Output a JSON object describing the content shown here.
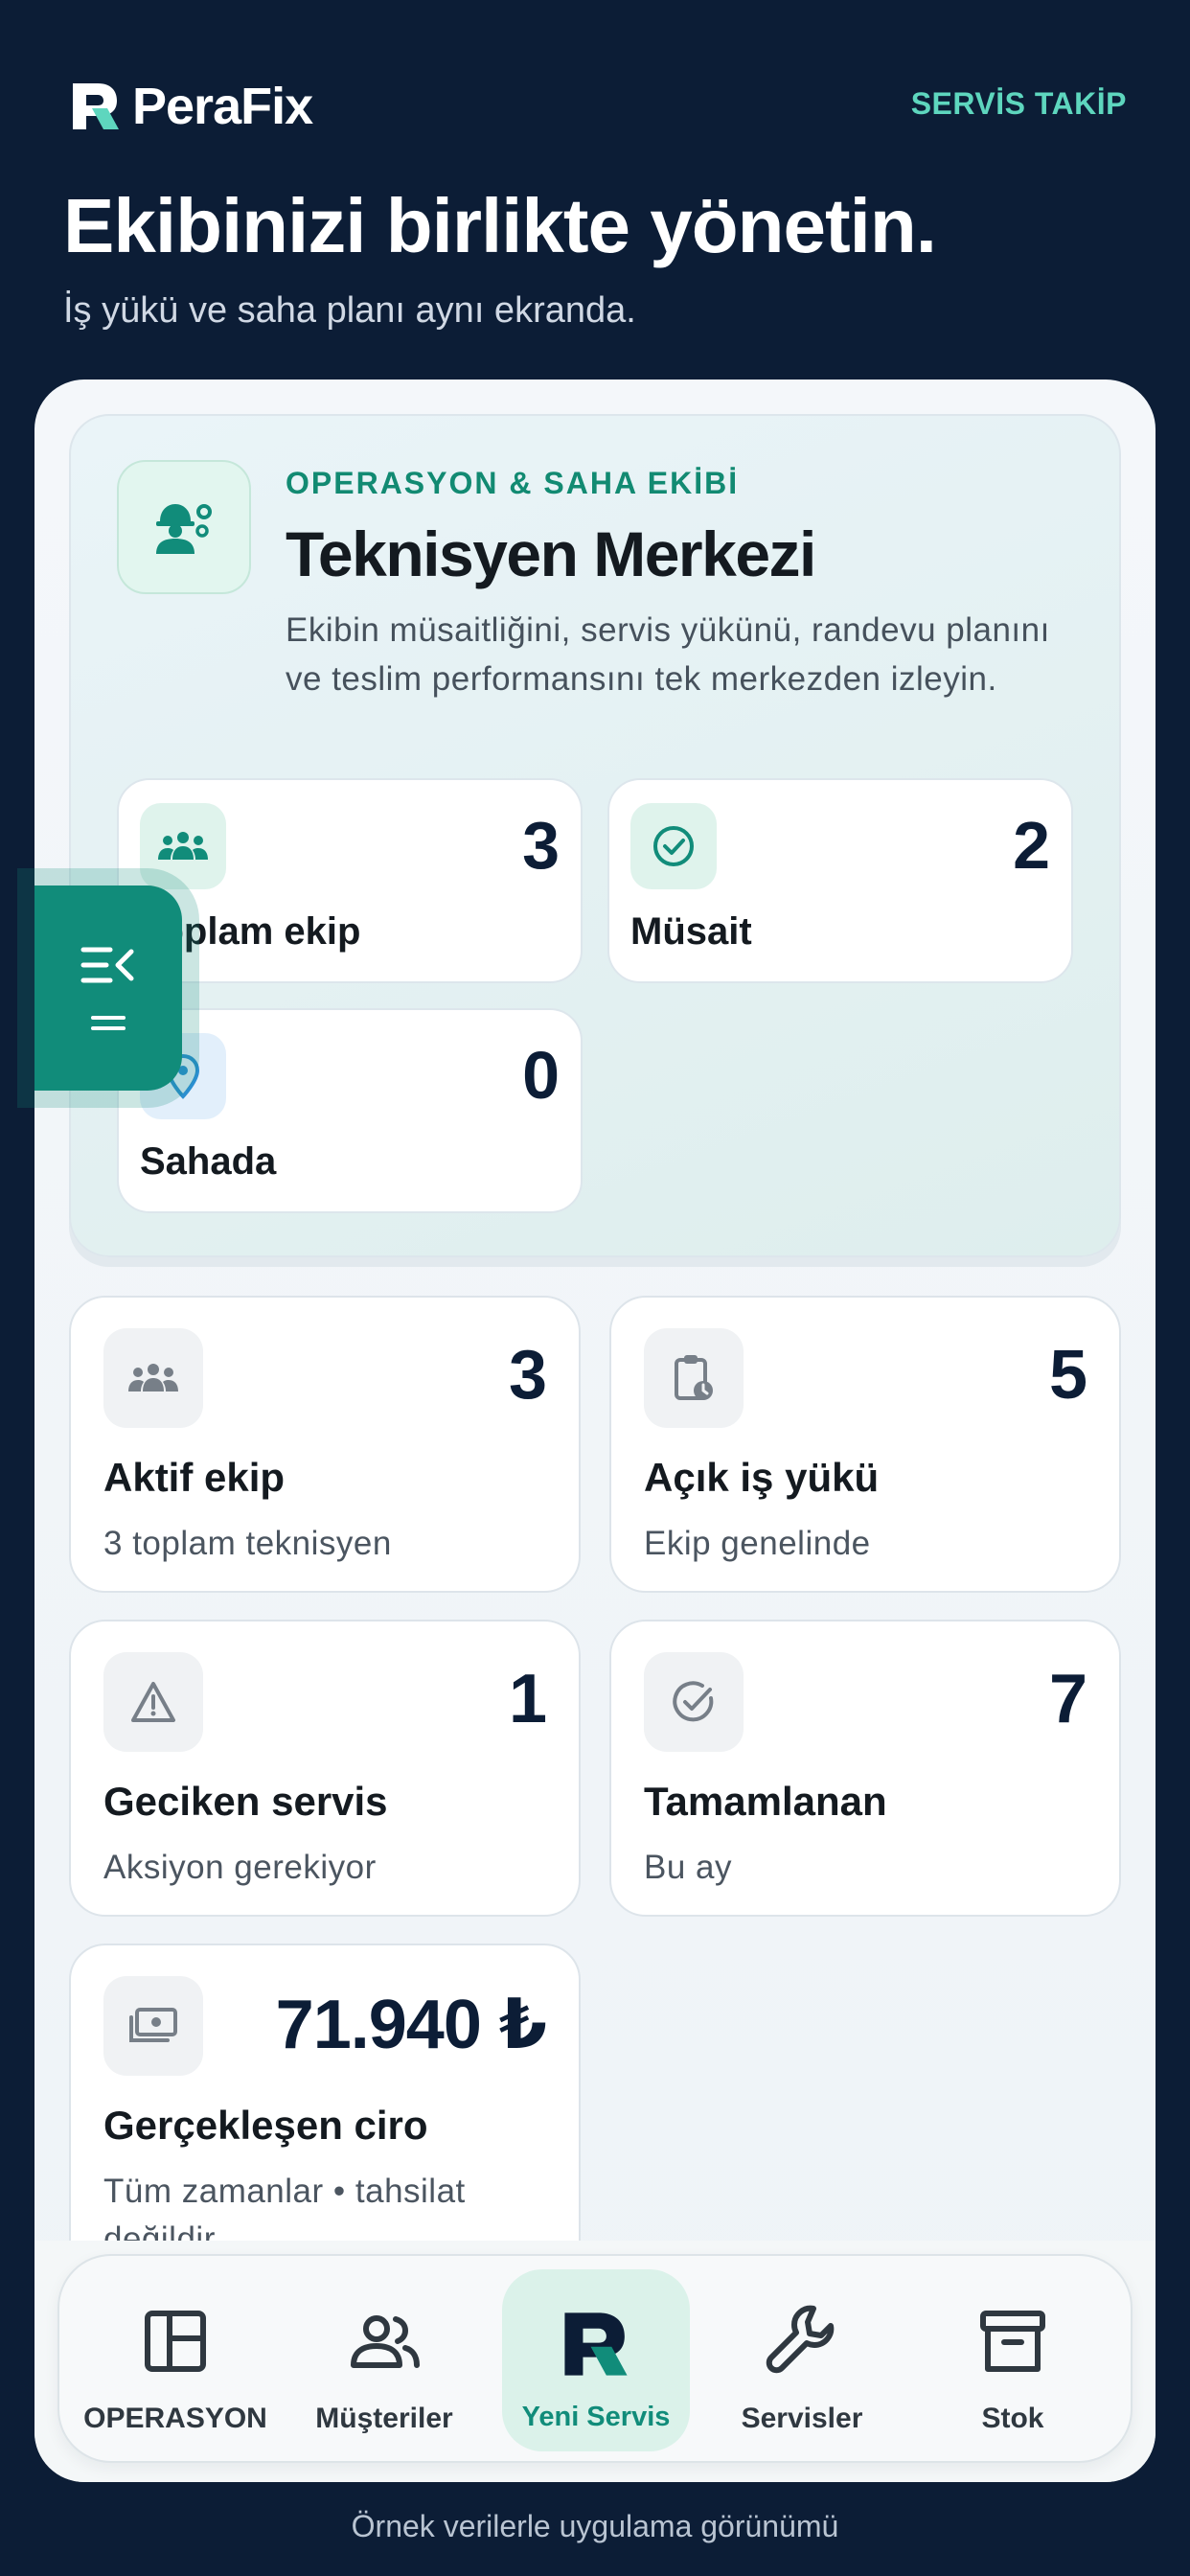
{
  "header": {
    "brand_name": "PeraFix",
    "servis_takip": "SERVİS TAKİP",
    "title": "Ekibinizi birlikte yönetin.",
    "subtitle": "İş yükü ve saha planı aynı ekranda."
  },
  "hub": {
    "icon": "technician-gear-icon",
    "eyebrow": "OPERASYON & SAHA EKİBİ",
    "title": "Teknisyen Merkezi",
    "description": "Ekibin müsaitliğini, servis yükünü, randevu planını ve teslim performansını tek merkezden izleyin.",
    "stats": [
      {
        "icon": "team-icon",
        "value": "3",
        "label": "Toplam ekip"
      },
      {
        "icon": "check-circle-icon",
        "value": "2",
        "label": "Müsait"
      },
      {
        "icon": "location-pin-icon",
        "value": "0",
        "label": "Sahada"
      }
    ]
  },
  "stats": [
    {
      "icon": "team-icon",
      "value": "3",
      "label": "Aktif ekip",
      "sub": "3 toplam teknisyen"
    },
    {
      "icon": "clipboard-clock-icon",
      "value": "5",
      "label": "Açık iş yükü",
      "sub": "Ekip genelinde"
    },
    {
      "icon": "warning-icon",
      "value": "1",
      "label": "Geciken servis",
      "sub": "Aksiyon gerekiyor"
    },
    {
      "icon": "check-circle-icon",
      "value": "7",
      "label": "Tamamlanan",
      "sub": "Bu ay"
    },
    {
      "icon": "cash-icon",
      "value": "71.940 ₺",
      "label": "Gerçekleşen ciro",
      "sub": "Tüm zamanlar • tahsilat değildir"
    }
  ],
  "fab": {
    "icon": "menu-collapse-icon"
  },
  "nav": [
    {
      "icon": "dashboard-icon",
      "label": "OPERASYON"
    },
    {
      "icon": "users-icon",
      "label": "Müşteriler"
    },
    {
      "icon": "perafix-logo-icon",
      "label": "Yeni Servis"
    },
    {
      "icon": "wrench-icon",
      "label": "Servisler"
    },
    {
      "icon": "archive-box-icon",
      "label": "Stok"
    }
  ],
  "footer": "Örnek verilerle uygulama görünümü",
  "colors": {
    "background": "#0c1d36",
    "accent": "#118c7a",
    "accent_light": "#5ed6be",
    "card": "#ffffff"
  }
}
